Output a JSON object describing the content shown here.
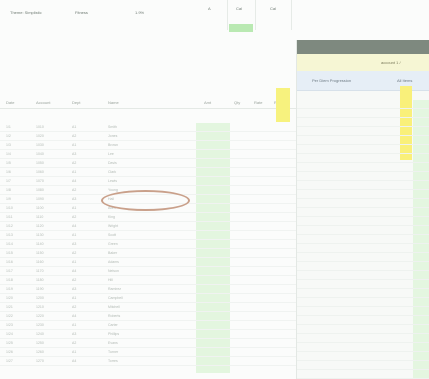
{
  "toolbar": {
    "field1_label": "Theme: Simplistic",
    "field2_label": "Fitness",
    "field3_label": "1.9%",
    "btn_a": "A",
    "btn_b": "Cal",
    "btn_c": "Cal"
  },
  "grid": {
    "columns": [
      "Date",
      "Account",
      "Dept",
      "Name",
      "Amt",
      "Qty",
      "Rate",
      "Ref"
    ],
    "rows": [
      [
        "1/1",
        "1010",
        "A1",
        "Smith"
      ],
      [
        "1/2",
        "1020",
        "A2",
        "Jones"
      ],
      [
        "1/3",
        "1030",
        "A1",
        "Brown"
      ],
      [
        "1/4",
        "1040",
        "A3",
        "Lee"
      ],
      [
        "1/5",
        "1050",
        "A2",
        "Davis"
      ],
      [
        "1/6",
        "1060",
        "A1",
        "Clark"
      ],
      [
        "1/7",
        "1070",
        "A4",
        "Lewis"
      ],
      [
        "1/8",
        "1080",
        "A2",
        "Young"
      ],
      [
        "1/9",
        "1090",
        "A3",
        "Hall"
      ],
      [
        "1/10",
        "1100",
        "A1",
        "Allen"
      ],
      [
        "1/11",
        "1110",
        "A2",
        "King"
      ],
      [
        "1/12",
        "1120",
        "A4",
        "Wright"
      ],
      [
        "1/13",
        "1130",
        "A1",
        "Scott"
      ],
      [
        "1/14",
        "1140",
        "A3",
        "Green"
      ],
      [
        "1/15",
        "1150",
        "A2",
        "Baker"
      ],
      [
        "1/16",
        "1160",
        "A1",
        "Adams"
      ],
      [
        "1/17",
        "1170",
        "A4",
        "Nelson"
      ],
      [
        "1/18",
        "1180",
        "A2",
        "Hill"
      ],
      [
        "1/19",
        "1190",
        "A3",
        "Ramirez"
      ],
      [
        "1/20",
        "1200",
        "A1",
        "Campbell"
      ],
      [
        "1/21",
        "1210",
        "A2",
        "Mitchell"
      ],
      [
        "1/22",
        "1220",
        "A4",
        "Roberts"
      ],
      [
        "1/23",
        "1230",
        "A1",
        "Carter"
      ],
      [
        "1/24",
        "1240",
        "A3",
        "Phillips"
      ],
      [
        "1/25",
        "1250",
        "A2",
        "Evans"
      ],
      [
        "1/26",
        "1260",
        "A1",
        "Turner"
      ],
      [
        "1/27",
        "1270",
        "A4",
        "Torres"
      ]
    ]
  },
  "panel": {
    "subtitle": "account 1 /",
    "col1": "Per Diem Progression",
    "col2": "All Items"
  },
  "colors": {
    "highlight_green": "#e3f6df",
    "highlight_yellow": "#f7f27e",
    "panel_title": "#7e897f"
  }
}
